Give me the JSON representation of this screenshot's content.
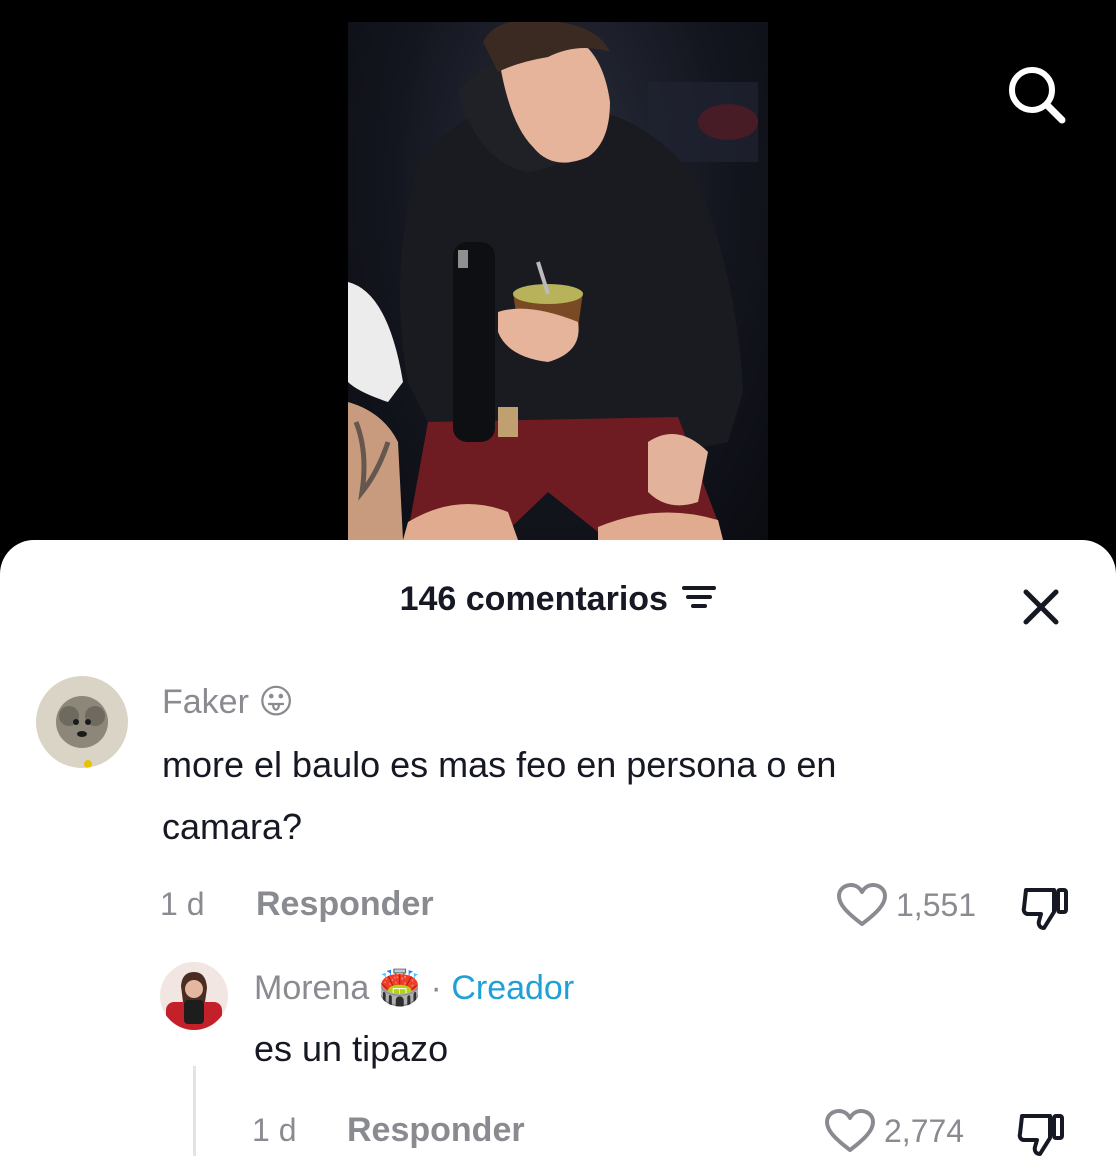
{
  "video": {
    "search_icon": "search-icon"
  },
  "comments_sheet": {
    "count_label": "146 comentarios",
    "sort_icon": "sort-lines-icon",
    "close_icon": "close-icon"
  },
  "comments": [
    {
      "username": "Faker",
      "emoji": "😛",
      "text_line1": "more el baulo es mas feo en persona o en",
      "text_line2": "camara?",
      "time": "1 d",
      "reply_label": "Responder",
      "likes": "1,551"
    }
  ],
  "replies": [
    {
      "username": "Morena",
      "emoji": "🏟️",
      "separator": "·",
      "creator_label": "Creador",
      "text": "es un tipazo",
      "time": "1 d",
      "reply_label": "Responder",
      "likes": "2,774"
    }
  ],
  "colors": {
    "creator": "#20a1d6",
    "muted": "#8a8b91",
    "text": "#161823"
  }
}
